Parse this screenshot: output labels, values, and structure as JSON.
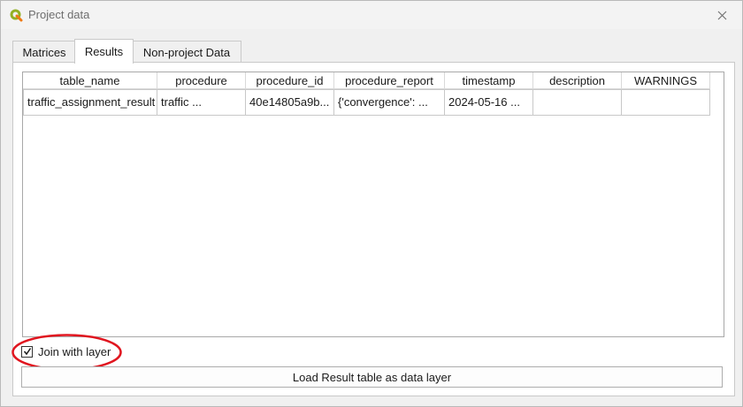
{
  "window": {
    "title": "Project data",
    "close_icon": "close-icon",
    "app_icon": "qgis-icon"
  },
  "tabs": [
    {
      "label": "Matrices",
      "active": false
    },
    {
      "label": "Results",
      "active": true
    },
    {
      "label": "Non-project Data",
      "active": false
    }
  ],
  "results_table": {
    "columns": [
      "table_name",
      "procedure",
      "procedure_id",
      "procedure_report",
      "timestamp",
      "description",
      "WARNINGS"
    ],
    "rows": [
      [
        "traffic_assignment_result",
        "traffic ...",
        "40e14805a9b...",
        "{'convergence': ...",
        "2024-05-16 ...",
        "",
        ""
      ]
    ]
  },
  "join_with_layer": {
    "label": "Join with layer",
    "checked": true
  },
  "load_button": {
    "label": "Load Result table as data layer"
  },
  "colors": {
    "annotation_red": "#e0151f"
  }
}
